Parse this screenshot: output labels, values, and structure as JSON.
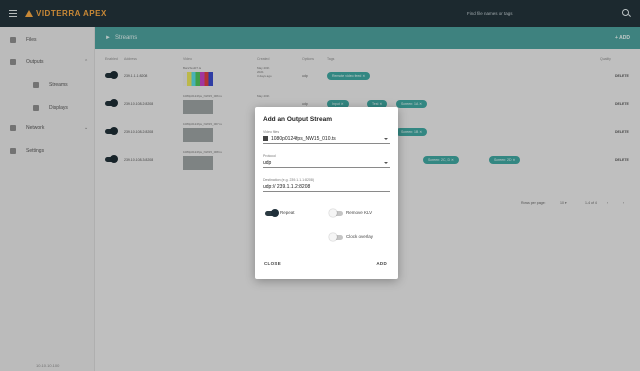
{
  "app": {
    "title": "VIDTERRA APEX"
  },
  "search": {
    "placeholder": "Find file names or tags"
  },
  "sidebar": {
    "items": [
      {
        "label": "Files"
      },
      {
        "label": "Outputs"
      },
      {
        "label": "Streams"
      },
      {
        "label": "Displays"
      },
      {
        "label": "Network"
      },
      {
        "label": "Settings"
      }
    ],
    "ip": "10.10.10.100"
  },
  "main": {
    "section_title": "Streams",
    "add_label": "+ ADD",
    "columns": [
      "Enabled",
      "Address",
      "Video",
      "Created",
      "Options",
      "Tags",
      "Quality"
    ],
    "rows": [
      {
        "address": "239.1.1.1:8208",
        "video": "BarsTest07.ts",
        "created": [
          "May 20th",
          "2021",
          "3 days ago"
        ],
        "option": "udp",
        "tags": [
          "Remote video feed ✕"
        ],
        "delete": "DELETE"
      },
      {
        "address": "239.10.108.2:8208",
        "video": "1080p0124fps_NW15_006.ts",
        "created": [
          "May 20th"
        ],
        "option": "udp",
        "tags": [
          "Input ✕",
          "Test ✕",
          "Screen: 1A ✕"
        ],
        "delete": "DELETE"
      },
      {
        "address": "239.10.108.2:8208",
        "video": "1080p0124fps_NW15_007.ts",
        "created": [],
        "option": "",
        "tags": [
          "Screen: 1B ✕"
        ],
        "delete": "DELETE"
      },
      {
        "address": "239.10.108.3:8208",
        "video": "1080p0124fps_NW15_008.ts",
        "created": [],
        "option": "",
        "tags": [
          "Input ✕",
          "Screen: 2B ✕",
          "Screen: 2C, D ✕",
          "Screen: 2D ✕"
        ],
        "delete": "DELETE"
      }
    ],
    "pager": {
      "rows_per_page": "Rows per page:",
      "rows_value": "10 ▾",
      "range": "1-4 of 4"
    }
  },
  "dialog": {
    "title": "Add an Output Stream",
    "video_file_label": "Video files",
    "video_file_value": "1080p0124fps_NW15_010.ts",
    "protocol_label": "Protocol",
    "protocol_value": "udp",
    "destination_label": "Destination (e.g. 239.1.1.1:8208)",
    "destination_value": "udp:// 239.1.1.2:8208",
    "repeat_label": "Repeat",
    "remove_klv_label": "Remove KLV",
    "clock_overlay_label": "Clock overlay",
    "close_label": "CLOSE",
    "add_label": "ADD"
  }
}
